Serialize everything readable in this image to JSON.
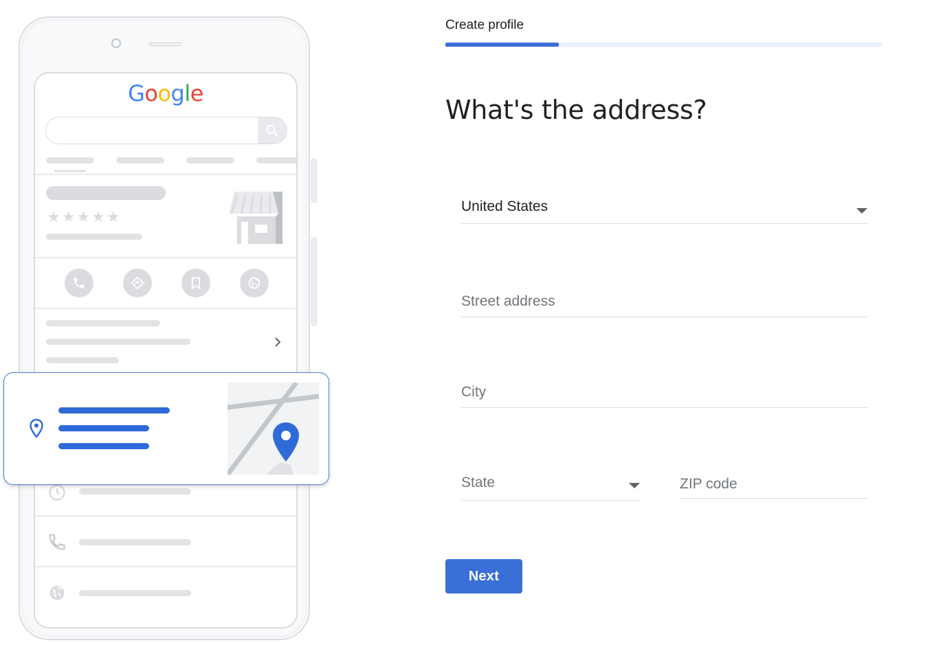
{
  "illustration": {
    "logo_letters": [
      {
        "char": "G",
        "color": "#4285F4"
      },
      {
        "char": "o",
        "color": "#EA4335"
      },
      {
        "char": "o",
        "color": "#FBBC05"
      },
      {
        "char": "g",
        "color": "#4285F4"
      },
      {
        "char": "l",
        "color": "#34A853"
      },
      {
        "char": "e",
        "color": "#EA4335"
      }
    ],
    "stars": "★★★★★",
    "action_icons": [
      "phone-icon",
      "directions-icon",
      "bookmark-icon",
      "website-icon"
    ],
    "row_icons": [
      "clock-icon",
      "phone-icon",
      "globe-icon"
    ],
    "card_icon": "location-pin-icon"
  },
  "header": {
    "tab_label": "Create profile",
    "progress_fraction": 0.26
  },
  "form": {
    "heading": "What's the address?",
    "country": {
      "value": "United States"
    },
    "street": {
      "placeholder": "Street address"
    },
    "city": {
      "placeholder": "City"
    },
    "state": {
      "placeholder": "State"
    },
    "zip": {
      "placeholder": "ZIP code"
    },
    "next_label": "Next"
  },
  "colors": {
    "accent": "#3a6fd8",
    "progress_track": "#e8f0fe",
    "pin_blue": "#2f6ad9"
  }
}
